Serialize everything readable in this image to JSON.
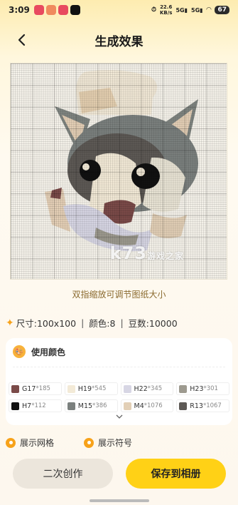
{
  "status_bar": {
    "time": "3:09",
    "net_speed_value": "22.6",
    "net_speed_unit": "KB/s",
    "signal1": "5G",
    "signal2": "5G",
    "battery": "67"
  },
  "header": {
    "title": "生成效果"
  },
  "pattern": {
    "watermark_main": "k73",
    "watermark_sub": "游戏之家"
  },
  "hint": "双指缩放可调节图纸大小",
  "stats": {
    "size_text": "尺寸:100x100",
    "colors_text": "颜色:8",
    "beads_text": "豆数:10000",
    "separator": "|"
  },
  "colors_panel": {
    "title": "使用颜色",
    "chips": [
      {
        "code": "G17",
        "count": "*185",
        "color": "#7a4a48"
      },
      {
        "code": "H19",
        "count": "*545",
        "color": "#f3ead7"
      },
      {
        "code": "H22",
        "count": "*345",
        "color": "#d7d6e4"
      },
      {
        "code": "H23",
        "count": "*301",
        "color": "#9d9a8f"
      },
      {
        "code": "H7",
        "count": "*112",
        "color": "#111111"
      },
      {
        "code": "M15",
        "count": "*386",
        "color": "#7b807e"
      },
      {
        "code": "M4",
        "count": "*1076",
        "color": "#e2cfb6"
      },
      {
        "code": "R13",
        "count": "*1067",
        "color": "#5d5955"
      }
    ]
  },
  "toggles": {
    "show_grid": "展示网格",
    "show_symbol": "展示符号"
  },
  "actions": {
    "secondary": "二次创作",
    "primary": "保存到相册"
  },
  "colors": {
    "accent": "#f7a21a",
    "primary_button": "#ffd116",
    "secondary_button": "#ece6dc"
  }
}
